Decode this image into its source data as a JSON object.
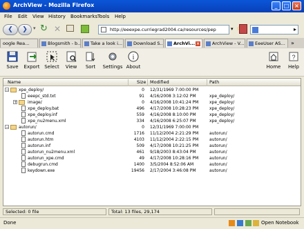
{
  "window": {
    "title": "ArchView - Mozilla Firefox"
  },
  "menu": [
    "File",
    "Edit",
    "View",
    "History",
    "Bookmarks",
    "Tools",
    "Help"
  ],
  "nav": {
    "url": "http://eeexpe.curriegrad2004.ca/resources/pep"
  },
  "tabs": [
    {
      "label": "oogle Rea..."
    },
    {
      "label": "Blogsmith - b..."
    },
    {
      "label": "Take a look i..."
    },
    {
      "label": "Download S..."
    },
    {
      "label": "ArchVi..."
    },
    {
      "label": "ArchView - V..."
    },
    {
      "label": "EeeUser AS..."
    }
  ],
  "toolbar": {
    "save": "Save",
    "export": "Export",
    "select": "Select",
    "view": "View",
    "sort": "Sort",
    "settings": "Settings",
    "about": "About",
    "home": "Home",
    "help": "Help"
  },
  "columns": {
    "name": "Name",
    "size": "Size",
    "modified": "Modified",
    "path": "Path"
  },
  "rows": [
    {
      "name": "xpe_deploy/",
      "size": "0",
      "modified": "12/31/1969 7:00:00 PM",
      "path": ""
    },
    {
      "name": "eeepc_std.txt",
      "size": "91",
      "modified": "4/16/2008 3:12:02 PM",
      "path": "xpe_deploy/"
    },
    {
      "name": "image/",
      "size": "0",
      "modified": "4/16/2008 10:41:24 PM",
      "path": "xpe_deploy/"
    },
    {
      "name": "xpe_deploy.bat",
      "size": "496",
      "modified": "4/17/2008 10:28:23 PM",
      "path": "xpe_deploy/"
    },
    {
      "name": "xpe_deploy.inf",
      "size": "559",
      "modified": "4/16/2008 8:10:00 PM",
      "path": "xpe_deploy/"
    },
    {
      "name": "xpe_nu2menu.xml",
      "size": "334",
      "modified": "4/16/2008 6:25:07 PM",
      "path": "xpe_deploy/"
    },
    {
      "name": "autorun/",
      "size": "0",
      "modified": "12/31/1969 7:00:00 PM",
      "path": ""
    },
    {
      "name": "autorun.cmd",
      "size": "1716",
      "modified": "11/12/2004 2:21:29 PM",
      "path": "autorun/"
    },
    {
      "name": "autorun.htm",
      "size": "4103",
      "modified": "11/12/2004 2:22:15 PM",
      "path": "autorun/"
    },
    {
      "name": "autorun.inf",
      "size": "509",
      "modified": "4/17/2008 10:21:25 PM",
      "path": "autorun/"
    },
    {
      "name": "autorun_nu2menu.xml",
      "size": "461",
      "modified": "9/18/2003 8:43:04 PM",
      "path": "autorun/"
    },
    {
      "name": "autorun_xpe.cmd",
      "size": "49",
      "modified": "4/17/2008 10:28:16 PM",
      "path": "autorun/"
    },
    {
      "name": "debugrun.cmd",
      "size": "1400",
      "modified": "3/5/2004 8:52:06 AM",
      "path": "autorun/"
    },
    {
      "name": "keydown.exe",
      "size": "19456",
      "modified": "2/17/2004 3:46:08 PM",
      "path": "autorun/"
    }
  ],
  "status": {
    "selected": "Selected: 0 file",
    "total": "Total: 13 files, 29,174"
  },
  "ffstatus": {
    "left": "Done",
    "right": "Open Notebook"
  }
}
